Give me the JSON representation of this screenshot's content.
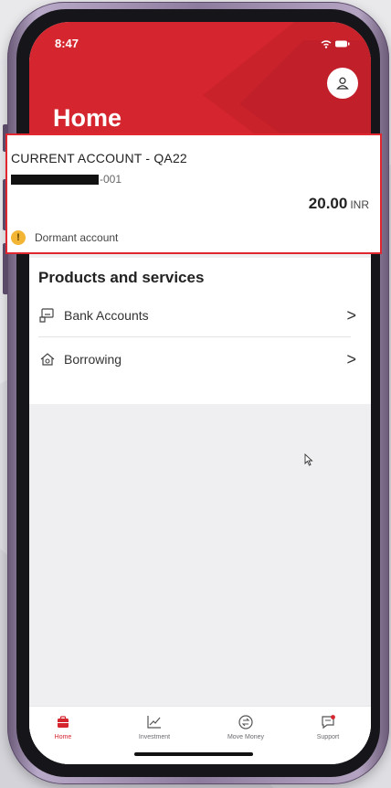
{
  "status_bar": {
    "time": "8:47"
  },
  "header": {
    "title": "Home",
    "profile_icon": "user-icon",
    "color": "#d5262f"
  },
  "account": {
    "name": "CURRENT ACCOUNT - QA22",
    "number_suffix": "-001",
    "balance": "20.00",
    "currency": "INR",
    "status": "Dormant account",
    "status_icon": "warning-icon",
    "highlight_color": "#e0262e"
  },
  "products": {
    "title": "Products and services",
    "items": [
      {
        "label": "Bank Accounts",
        "icon": "bank-accounts-icon"
      },
      {
        "label": "Borrowing",
        "icon": "borrowing-icon"
      }
    ]
  },
  "tabbar": {
    "tabs": [
      {
        "label": "Home",
        "icon": "home-icon",
        "active": true
      },
      {
        "label": "Investment",
        "icon": "investment-chart-icon",
        "active": false
      },
      {
        "label": "Move Money",
        "icon": "move-money-icon",
        "active": false
      },
      {
        "label": "Support",
        "icon": "support-icon",
        "active": false
      }
    ]
  }
}
